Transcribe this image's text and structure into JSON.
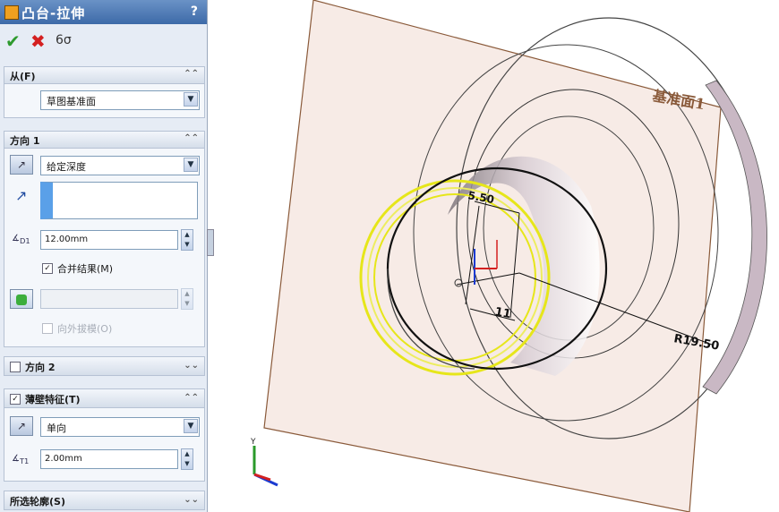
{
  "panel": {
    "title": "凸台-拉伸",
    "help": "?",
    "actions": {
      "ok": "✔",
      "cancel": "✖",
      "preview": "6σ"
    },
    "from": {
      "header": "从(F)",
      "value": "草图基准面"
    },
    "direction1": {
      "header": "方向 1",
      "end_condition": "给定深度",
      "depth": "12.00mm",
      "depth_icon": "D1",
      "merge_label": "合并结果(M)",
      "merge_checked": true,
      "draft_label": "向外拔模(O)"
    },
    "direction2": {
      "header": "方向 2"
    },
    "thin": {
      "header": "薄壁特征(T)",
      "type": "单向",
      "thickness": "2.00mm",
      "thickness_icon": "T1"
    },
    "selected_contours": {
      "header": "所选轮廓(S)"
    }
  },
  "viewport": {
    "plane_label": "基准面1",
    "dim_radius": "R19.50",
    "dim_top": "5.50",
    "dim_bottom": "11",
    "triad_label": "Y"
  },
  "colors": {
    "plane_fill": "#f7ebe6",
    "plane_edge": "#8a5a3a",
    "highlight": "#e6e61a",
    "ok_green": "#2e9a2e",
    "cancel_red": "#d42020"
  }
}
